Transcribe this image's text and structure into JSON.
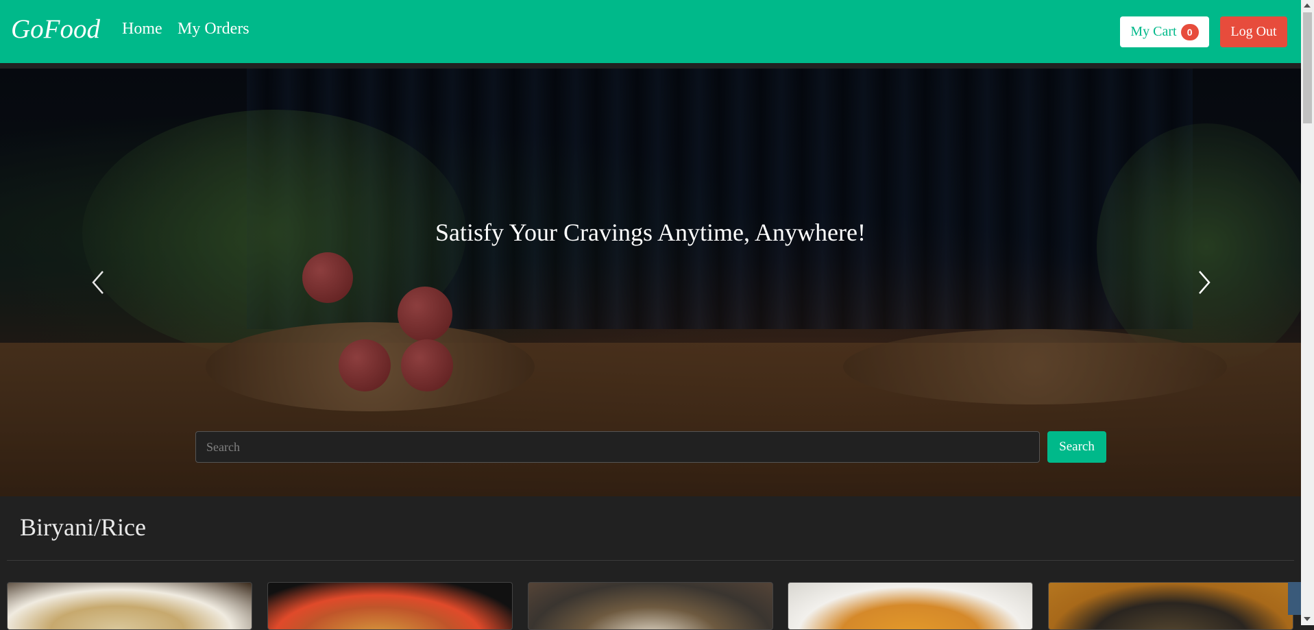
{
  "navbar": {
    "brand": "GoFood",
    "links": [
      "Home",
      "My Orders"
    ],
    "cart_label": "My Cart",
    "cart_count": "0",
    "logout_label": "Log Out"
  },
  "hero": {
    "title": "Satisfy Your Cravings Anytime, Anywhere!",
    "search_placeholder": "Search",
    "search_button": "Search"
  },
  "category": {
    "title": "Biryani/Rice"
  },
  "colors": {
    "accent": "#00b98a",
    "danger": "#e74c3c",
    "background": "#212121"
  },
  "icons": {
    "carousel_prev": "chevron-left-icon",
    "carousel_next": "chevron-right-icon"
  }
}
